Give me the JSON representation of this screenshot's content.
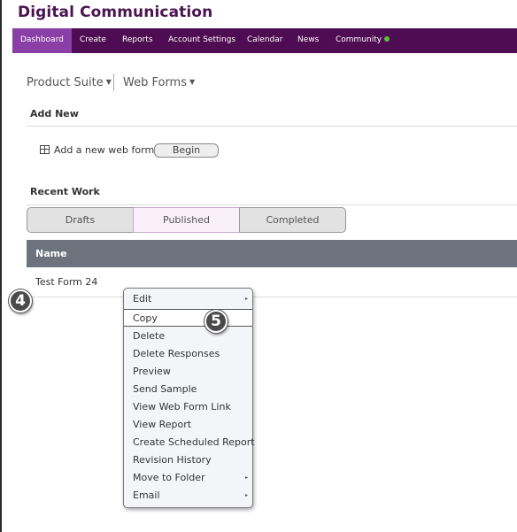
{
  "app": {
    "title": "Digital Communication"
  },
  "nav": {
    "items": [
      {
        "label": "Dashboard",
        "active": true
      },
      {
        "label": "Create"
      },
      {
        "label": "Reports"
      },
      {
        "label": "Account Settings"
      },
      {
        "label": "Calendar"
      },
      {
        "label": "News"
      },
      {
        "label": "Community"
      }
    ],
    "community_status_color": "#5cbf3a"
  },
  "product_bar": {
    "suite": "Product Suite",
    "module": "Web Forms"
  },
  "add_new": {
    "title": "Add New",
    "item_label": "Add a new web form",
    "icon": "table-icon",
    "begin_label": "Begin"
  },
  "recent_work": {
    "title": "Recent Work",
    "tabs": [
      "Drafts",
      "Published",
      "Completed"
    ],
    "selected_tab": "Published"
  },
  "table": {
    "columns": [
      "Name"
    ],
    "rows": [
      {
        "name": "Test Form 24"
      }
    ]
  },
  "callouts": [
    "4",
    "5"
  ],
  "context_menu": {
    "items": [
      {
        "label": "Edit",
        "submenu": true
      },
      {
        "label": "Copy",
        "highlighted": true
      },
      {
        "label": "Delete"
      },
      {
        "label": "Delete Responses"
      },
      {
        "label": "Preview"
      },
      {
        "label": "Send Sample"
      },
      {
        "label": "View Web Form Link"
      },
      {
        "label": "View Report"
      },
      {
        "label": "Create Scheduled Report"
      },
      {
        "label": "Revision History"
      },
      {
        "label": "Move to Folder",
        "submenu": true
      },
      {
        "label": "Email",
        "submenu": true
      }
    ],
    "submenu_arrow": "▸"
  },
  "colors": {
    "brand": "#4e0d52",
    "nav_active": "#8a3fa6",
    "table_header": "#6d737c",
    "selected_tab": "#fbeffb"
  }
}
